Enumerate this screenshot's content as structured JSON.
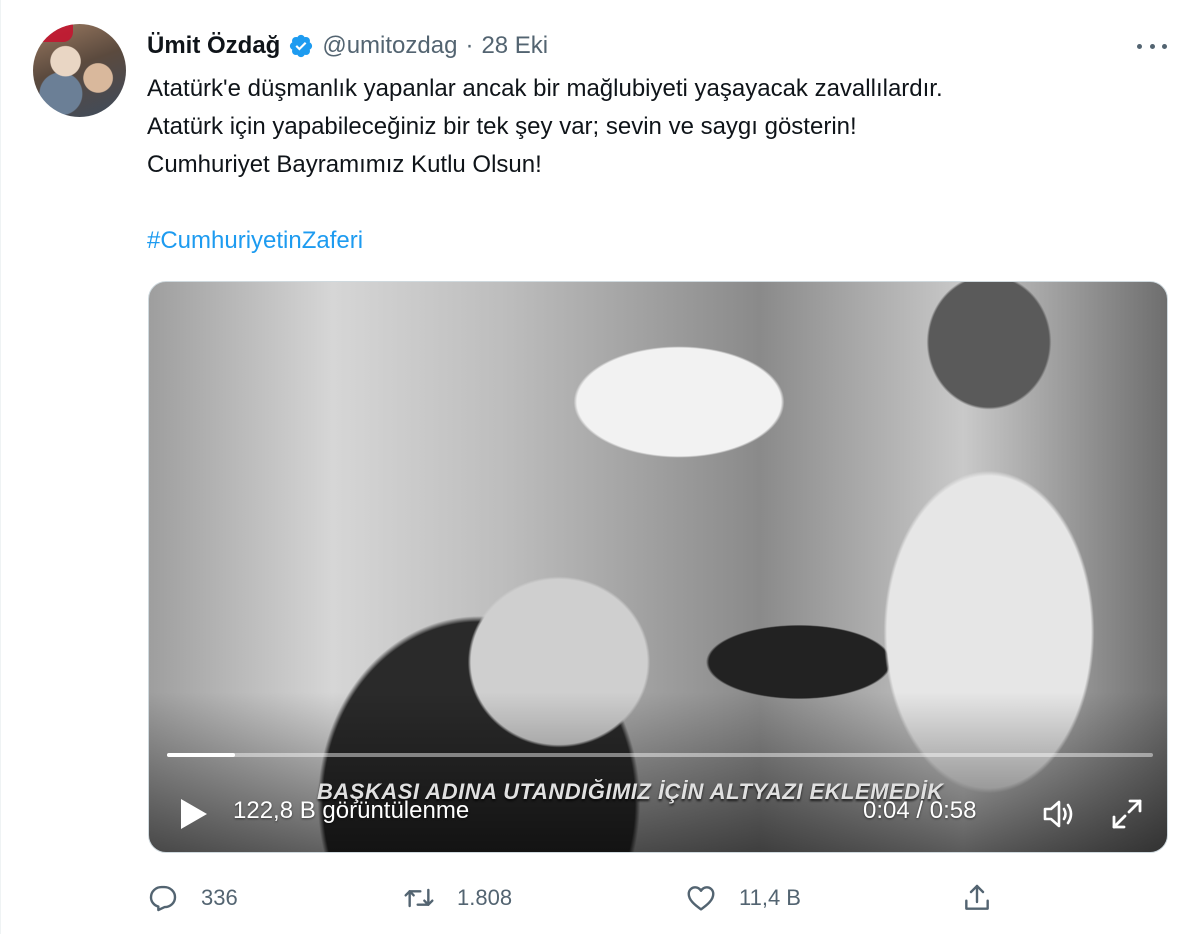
{
  "author": {
    "name": "Ümit Özdağ",
    "handle": "@umitozdag",
    "separator": "·",
    "date": "28 Eki"
  },
  "tweet": {
    "lines": [
      "Atatürk'e düşmanlık yapanlar ancak bir mağlubiyeti yaşayacak zavallılardır.",
      "Atatürk için yapabileceğiniz bir tek şey var; sevin ve saygı gösterin!",
      "Cumhuriyet Bayramımız Kutlu Olsun!"
    ],
    "hashtag": "#CumhuriyetinZaferi"
  },
  "video": {
    "subtitle": "BAŞKASI ADINA UTANDIĞIMIZ İÇİN ALTYAZI EKLEMEDİK",
    "views": "122,8 B görüntülenme",
    "time": "0:04 / 0:58",
    "progress_fraction": 0.069
  },
  "actions": {
    "replies": "336",
    "retweets": "1.808",
    "likes": "11,4 B"
  },
  "colors": {
    "link": "#1d9bf0",
    "verified": "#1d9bf0",
    "secondary_text": "#536471"
  }
}
